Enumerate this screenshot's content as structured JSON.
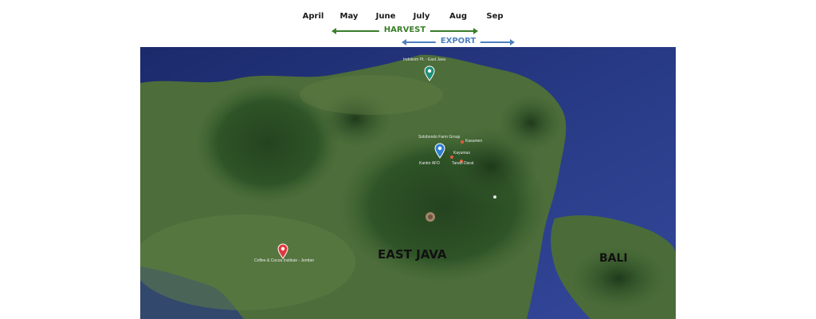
{
  "timeline": {
    "months": [
      "April",
      "May",
      "June",
      "July",
      "Aug",
      "Sep"
    ],
    "harvest": {
      "label": "HARVEST",
      "color": "#3a7d2a"
    },
    "export": {
      "label": "EXPORT",
      "color": "#4d7fbf"
    }
  },
  "map": {
    "regions": {
      "east_java": "EAST JAVA",
      "bali": "BALI"
    },
    "pins": {
      "north_coast": {
        "label": "Indokom Pt. - East Java",
        "color": "#1f8f7a"
      },
      "farm": {
        "label": "Solobondo Farm Group",
        "color": "#2f7fd1"
      },
      "jember": {
        "label": "Coffee & Cocoa Institute - Jember",
        "color": "#e0393e"
      }
    },
    "points": {
      "kasumen": "Kasumen",
      "kayumas": "Kayumas",
      "kantor": "Kantor AFD",
      "tanah_darat": "Tanah Darat"
    }
  }
}
